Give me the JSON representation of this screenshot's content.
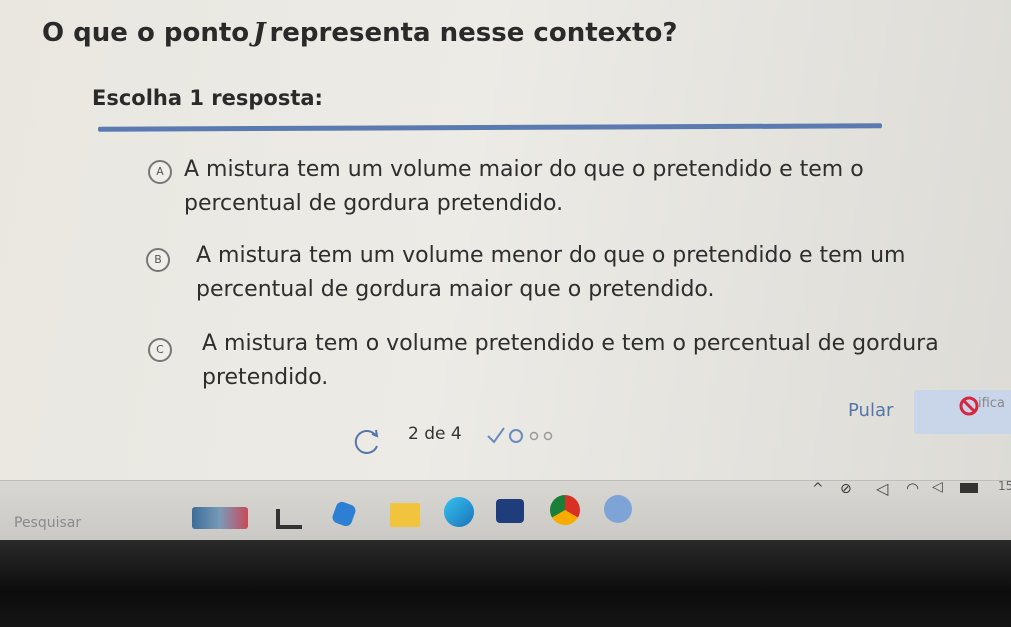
{
  "question": {
    "prefix": "O que o ponto",
    "symbol": "J",
    "suffix": "representa nesse contexto?"
  },
  "instruction": "Escolha 1 resposta:",
  "options": [
    {
      "letter": "A",
      "line1": "A mistura tem um volume maior do que o pretendido e tem o",
      "line2": "percentual de gordura pretendido."
    },
    {
      "letter": "B",
      "line1": "A mistura tem um volume menor do que o pretendido e tem um",
      "line2": "percentual de gordura maior que o pretendido."
    },
    {
      "letter": "C",
      "line1": "A mistura tem o volume pretendido e tem o percentual de gordura",
      "line2": "pretendido."
    }
  ],
  "progress": {
    "text": "2 de 4"
  },
  "actions": {
    "skip_label": "Pular",
    "verify_label": "ifica"
  },
  "taskbar": {
    "search_placeholder": "Pesquisar",
    "clock": "15"
  },
  "colors": {
    "accent": "#5676a8",
    "divider": "#5b7ab0",
    "verify_bg": "#c9d6ea",
    "error": "#d7263d"
  }
}
